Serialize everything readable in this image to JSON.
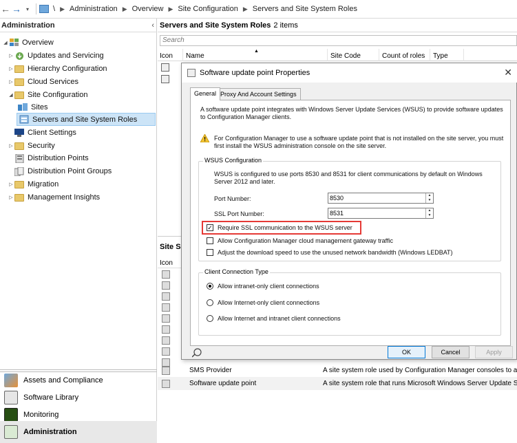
{
  "breadcrumb": [
    "\\",
    "Administration",
    "Overview",
    "Site Configuration",
    "Servers and Site System Roles"
  ],
  "left": {
    "title": "Administration",
    "collapse": "‹",
    "tree": [
      {
        "label": "Overview"
      },
      {
        "label": "Updates and Servicing"
      },
      {
        "label": "Hierarchy Configuration"
      },
      {
        "label": "Cloud Services"
      },
      {
        "label": "Site Configuration"
      },
      {
        "label": "Sites"
      },
      {
        "label": "Servers and Site System Roles"
      },
      {
        "label": "Client Settings"
      },
      {
        "label": "Security"
      },
      {
        "label": "Distribution Points"
      },
      {
        "label": "Distribution Point Groups"
      },
      {
        "label": "Migration"
      },
      {
        "label": "Management Insights"
      }
    ],
    "workspaces": [
      "Assets and Compliance",
      "Software Library",
      "Monitoring",
      "Administration"
    ]
  },
  "main": {
    "title": "Servers and Site System Roles",
    "count": "2 items",
    "search_placeholder": "Search",
    "columns": [
      "Icon",
      "Name",
      "Site Code",
      "Count of roles",
      "Type"
    ],
    "lower_title": "Site S",
    "lower_icon_col": "Icon",
    "rows": [
      {
        "name": "SMS Provider",
        "desc": "A site system role used by Configuration Manager consoles to acces"
      },
      {
        "name": "Software update point",
        "desc": "A site system role that runs Microsoft Windows Server Update Servic"
      }
    ]
  },
  "dialog": {
    "title": "Software update point Properties",
    "close": "✕",
    "tabs": [
      "General",
      "Proxy And Account Settings"
    ],
    "intro": "A software update point integrates with Windows Server Update Services (WSUS) to provide software updates to Configuration Manager clients.",
    "warning": "For Configuration Manager to use a software update point that is not installed on the site server, you must first install the WSUS administration console on the site server.",
    "wsus_group": "WSUS Configuration",
    "wsus_text": "WSUS is configured to use ports 8530 and 8531 for client communications by default on Windows Server 2012 and later.",
    "port_label": "Port Number:",
    "port_value": "8530",
    "ssl_port_label": "SSL Port Number:",
    "ssl_port_value": "8531",
    "chk_ssl": "Require SSL communication to the WSUS server",
    "chk_cmg": "Allow Configuration Manager cloud management gateway traffic",
    "chk_ledbat": "Adjust the download speed to use the unused network bandwidth (Windows LEDBAT)",
    "client_group": "Client Connection Type",
    "radio1": "Allow intranet-only client connections",
    "radio2": "Allow Internet-only client connections",
    "radio3": "Allow Internet and intranet client connections",
    "ok": "OK",
    "cancel": "Cancel",
    "apply": "Apply"
  },
  "colors": {
    "highlight": "#e53935",
    "selected": "#cce4f7",
    "folder": "#e8c86a"
  }
}
